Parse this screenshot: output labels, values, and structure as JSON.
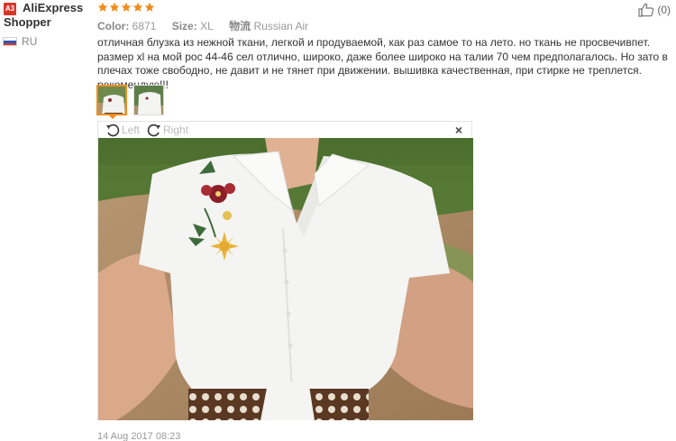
{
  "buyer": {
    "badge": "A3",
    "name_line1": "AliExpress",
    "name_line2": "Shopper",
    "country": "RU"
  },
  "rating": {
    "stars": 5,
    "max": 5,
    "color": "#f08c1c"
  },
  "meta": {
    "color_label": "Color:",
    "color_value": "6871",
    "size_label": "Size:",
    "size_value": "XL",
    "shipping_label": "物流",
    "shipping_value": "Russian Air"
  },
  "helpful": {
    "count": "(0)",
    "icon": "thumbs-up-icon"
  },
  "review": {
    "text": "отличная блузка из нежной ткани, легкой и продуваемой, как раз самое то на лето. но ткань не просвечивпет. размер xl на мой рос 44-46 сел отлично, широко, даже более широко на талии 70 чем предполагалось. Но зато в плечах тоже свободно, не давит и не тянет при движении. вышивка качественная, при стирке не треплется. рекомендую!!!"
  },
  "viewer": {
    "rotate_left_label": "Left",
    "rotate_right_label": "Right",
    "close_label": "×"
  },
  "date": "14 Aug 2017 08:23",
  "colors": {
    "accent": "#f08c1c",
    "badge": "#d9362a"
  }
}
